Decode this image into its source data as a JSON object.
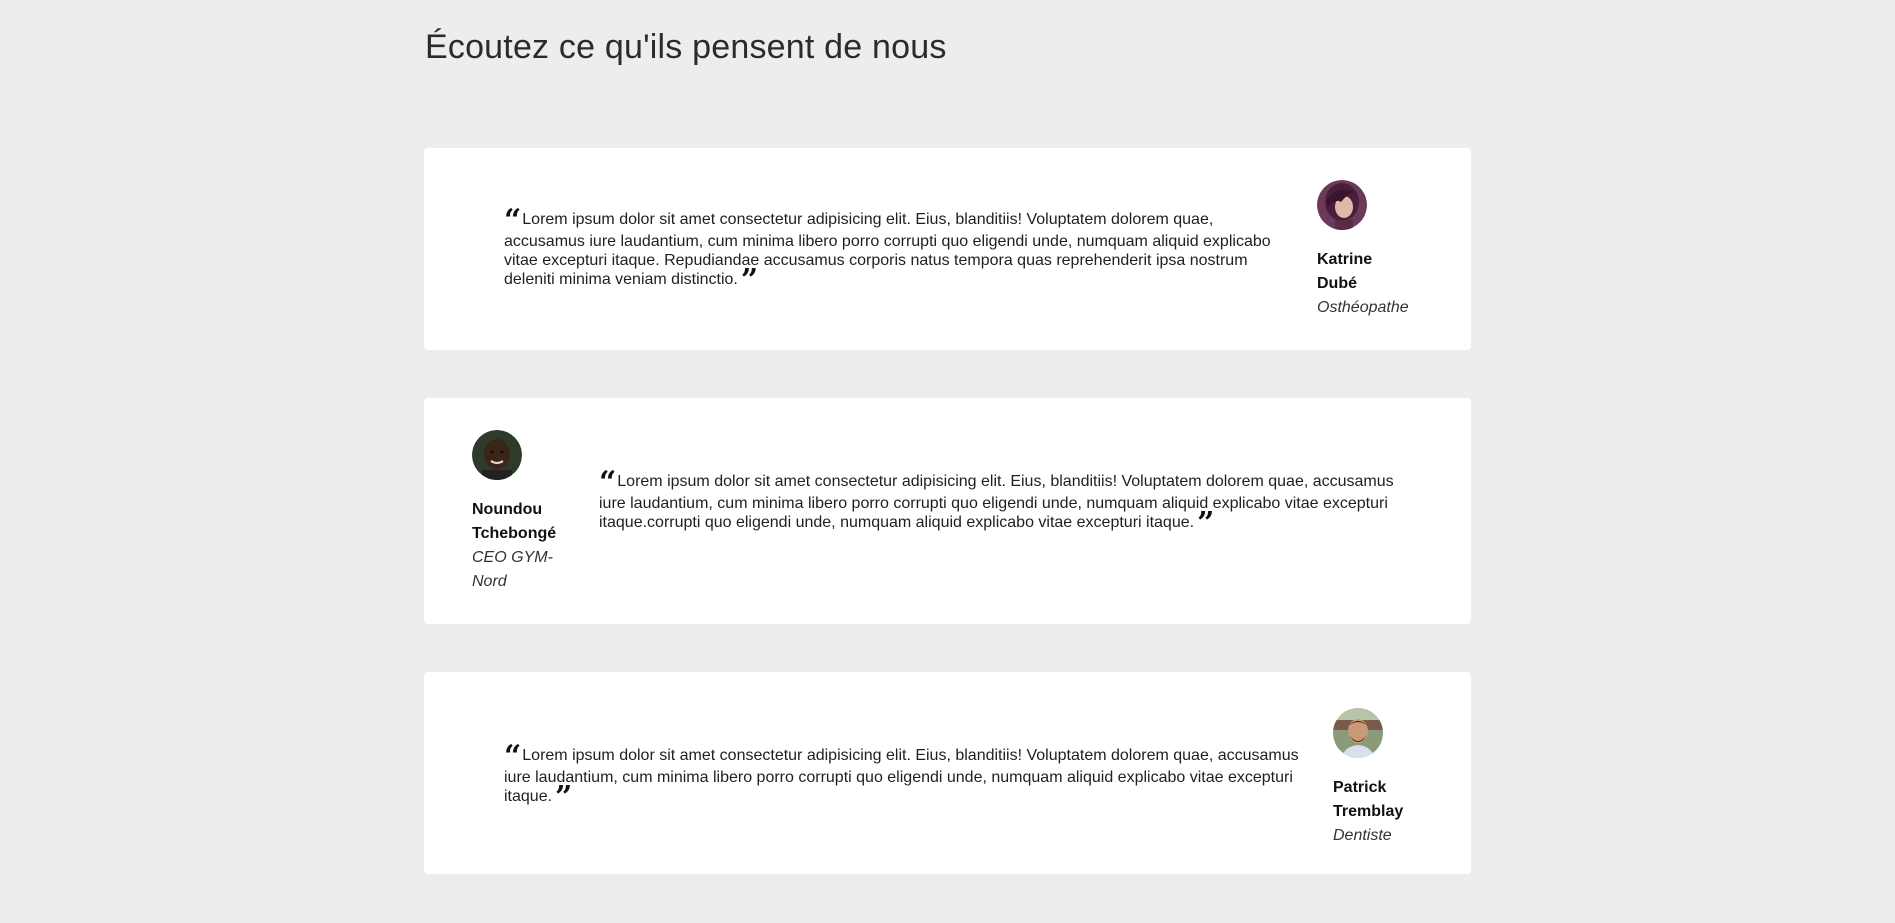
{
  "section": {
    "title": "Écoutez ce qu'ils pensent de nous"
  },
  "testimonials": [
    {
      "quote": "Lorem ipsum dolor sit amet consectetur adipisicing elit. Eius, blanditiis! Voluptatem dolorem quae, accusamus iure laudantium, cum minima libero porro corrupti quo eligendi unde, numquam aliquid explicabo vitae excepturi itaque. Repudiandae accusamus corporis natus tempora quas reprehenderit ipsa nostrum deleniti minima veniam distinctio.",
      "name_line1": "Katrine",
      "name_line2": "Dubé",
      "role": "Osthéopathe",
      "avatar_icon": "woman-portrait-avatar"
    },
    {
      "quote": "Lorem ipsum dolor sit amet consectetur adipisicing elit. Eius, blanditiis! Voluptatem dolorem quae, accusamus iure laudantium, cum minima libero porro corrupti quo eligendi unde, numquam aliquid explicabo vitae excepturi itaque.corrupti quo eligendi unde, numquam aliquid explicabo vitae excepturi itaque.",
      "name_line1": "Noundou",
      "name_line2": "Tchebongé",
      "role": "CEO GYM-Nord",
      "avatar_icon": "man-portrait-avatar"
    },
    {
      "quote": "Lorem ipsum dolor sit amet consectetur adipisicing elit. Eius, blanditiis! Voluptatem dolorem quae, accusamus iure laudantium, cum minima libero porro corrupti quo eligendi unde, numquam aliquid explicabo vitae excepturi itaque.",
      "name_line1": "Patrick",
      "name_line2": "Tremblay",
      "role": "Dentiste",
      "avatar_icon": "man-outdoor-portrait-avatar"
    }
  ],
  "quote_marks": {
    "open": "“",
    "close": "”"
  },
  "colors": {
    "background": "#ededed",
    "card": "#ffffff",
    "text": "#1f1f1f"
  }
}
